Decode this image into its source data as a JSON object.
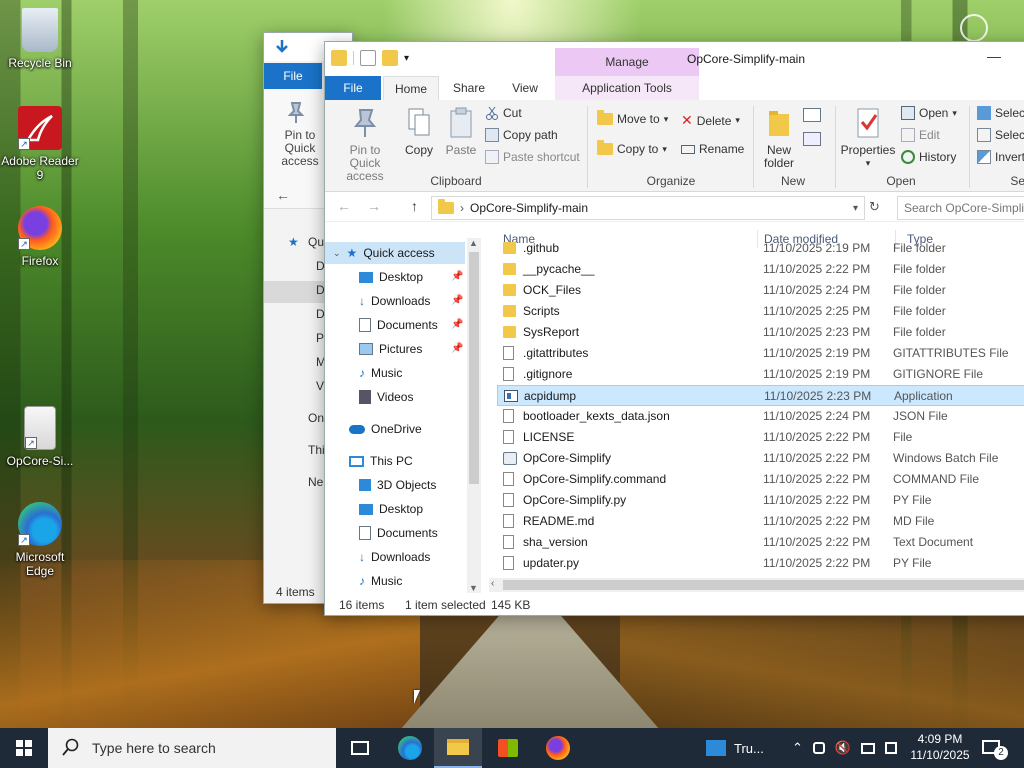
{
  "desktop": {
    "icons": [
      {
        "label": "Recycle Bin"
      },
      {
        "label": "Adobe Reader 9"
      },
      {
        "label": "Firefox"
      },
      {
        "label": "OpCore-Si..."
      },
      {
        "label": "Microsoft Edge"
      }
    ]
  },
  "back_window": {
    "file_tab": "File",
    "pin_label": "Pin to Quick access",
    "nav_items": [
      "Qu",
      "D",
      "D",
      "D",
      "P",
      "M",
      "V",
      "On",
      "Thi",
      "Ne"
    ],
    "status": "4 items"
  },
  "window": {
    "title": "OpCore-Simplify-main",
    "manage_tab": "Manage",
    "minimize_glyph": "—",
    "tabs": {
      "file": "File",
      "home": "Home",
      "share": "Share",
      "view": "View",
      "app_tools": "Application Tools"
    },
    "ribbon": {
      "clipboard": {
        "group": "Clipboard",
        "pin": "Pin to Quick access",
        "copy": "Copy",
        "paste": "Paste",
        "cut": "Cut",
        "copy_path": "Copy path",
        "paste_shortcut": "Paste shortcut"
      },
      "organize": {
        "group": "Organize",
        "move_to": "Move to",
        "copy_to": "Copy to",
        "delete": "Delete",
        "rename": "Rename"
      },
      "new": {
        "group": "New",
        "new_folder": "New folder"
      },
      "open": {
        "group": "Open",
        "properties": "Properties",
        "open": "Open",
        "edit": "Edit",
        "history": "History"
      },
      "select": {
        "group": "Sel",
        "select_all": "Select",
        "select_none": "Select",
        "invert": "Invert"
      }
    },
    "address": {
      "path": "OpCore-Simplify-main",
      "search_placeholder": "Search OpCore-Simplify-main"
    },
    "nav": {
      "quick_access": "Quick access",
      "qa_items": [
        "Desktop",
        "Downloads",
        "Documents",
        "Pictures"
      ],
      "music": "Music",
      "videos": "Videos",
      "onedrive": "OneDrive",
      "this_pc": "This PC",
      "pc_items": [
        "3D Objects",
        "Desktop",
        "Documents",
        "Downloads",
        "Music"
      ]
    },
    "columns": {
      "name": "Name",
      "date": "Date modified",
      "type": "Type"
    },
    "files": [
      {
        "name": ".github",
        "date": "11/10/2025 2:19 PM",
        "type": "File folder",
        "kind": "folder"
      },
      {
        "name": "__pycache__",
        "date": "11/10/2025 2:22 PM",
        "type": "File folder",
        "kind": "folder"
      },
      {
        "name": "OCK_Files",
        "date": "11/10/2025 2:24 PM",
        "type": "File folder",
        "kind": "folder"
      },
      {
        "name": "Scripts",
        "date": "11/10/2025 2:25 PM",
        "type": "File folder",
        "kind": "folder"
      },
      {
        "name": "SysReport",
        "date": "11/10/2025 2:23 PM",
        "type": "File folder",
        "kind": "folder"
      },
      {
        "name": ".gitattributes",
        "date": "11/10/2025 2:19 PM",
        "type": "GITATTRIBUTES File",
        "kind": "file"
      },
      {
        "name": ".gitignore",
        "date": "11/10/2025 2:19 PM",
        "type": "GITIGNORE File",
        "kind": "file"
      },
      {
        "name": "acpidump",
        "date": "11/10/2025 2:23 PM",
        "type": "Application",
        "kind": "app",
        "selected": true
      },
      {
        "name": "bootloader_kexts_data.json",
        "date": "11/10/2025 2:24 PM",
        "type": "JSON File",
        "kind": "file"
      },
      {
        "name": "LICENSE",
        "date": "11/10/2025 2:22 PM",
        "type": "File",
        "kind": "file"
      },
      {
        "name": "OpCore-Simplify",
        "date": "11/10/2025 2:22 PM",
        "type": "Windows Batch File",
        "kind": "bat"
      },
      {
        "name": "OpCore-Simplify.command",
        "date": "11/10/2025 2:22 PM",
        "type": "COMMAND File",
        "kind": "file"
      },
      {
        "name": "OpCore-Simplify.py",
        "date": "11/10/2025 2:22 PM",
        "type": "PY File",
        "kind": "file"
      },
      {
        "name": "README.md",
        "date": "11/10/2025 2:22 PM",
        "type": "MD File",
        "kind": "file"
      },
      {
        "name": "sha_version",
        "date": "11/10/2025 2:22 PM",
        "type": "Text Document",
        "kind": "file"
      },
      {
        "name": "updater.py",
        "date": "11/10/2025 2:22 PM",
        "type": "PY File",
        "kind": "file"
      }
    ],
    "status": {
      "count": "16 items",
      "selected": "1 item selected",
      "size": "145 KB"
    }
  },
  "taskbar": {
    "search_placeholder": "Type here to search",
    "news": "Tru...",
    "time": "4:09 PM",
    "date": "11/10/2025",
    "notifications": "2"
  },
  "colors": {
    "accent": "#1a73c8",
    "selection": "#cce8ff",
    "manage": "#ecc9f4",
    "taskbar": "#1f2a38"
  }
}
